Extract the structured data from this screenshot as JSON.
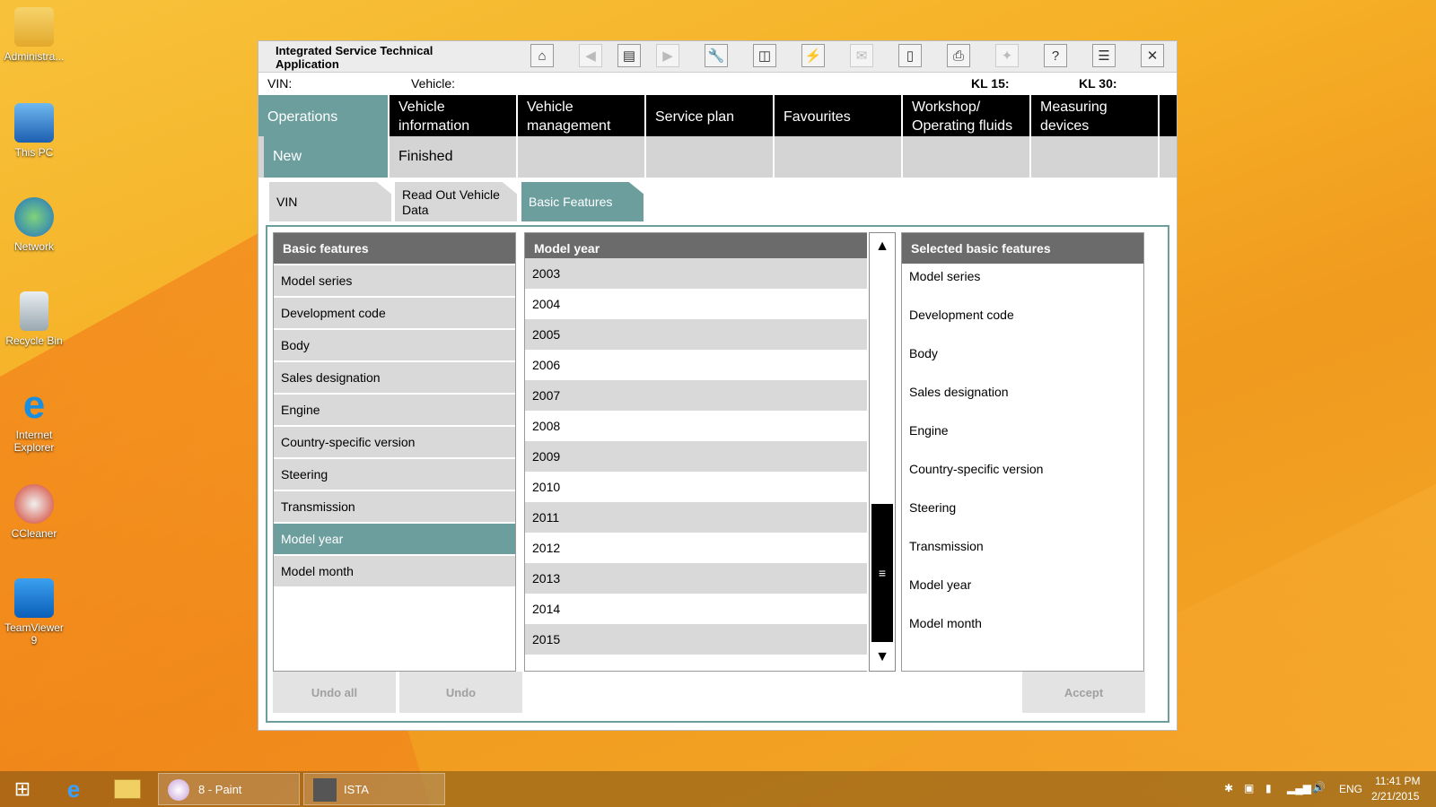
{
  "desktop": {
    "icons": [
      {
        "label": "Administra..."
      },
      {
        "label": "This PC"
      },
      {
        "label": "Network"
      },
      {
        "label": "Recycle Bin"
      },
      {
        "label": "Internet Explorer"
      },
      {
        "label": "CCleaner"
      },
      {
        "label": "TeamViewer 9"
      }
    ]
  },
  "window": {
    "title": "Integrated Service Technical Application",
    "status": {
      "vin": "VIN:",
      "vehicle": "Vehicle:",
      "kl15": "KL 15:",
      "kl30": "KL 30:"
    },
    "main_nav": [
      {
        "label": "Operations"
      },
      {
        "label": "Vehicle information"
      },
      {
        "label": "Vehicle management"
      },
      {
        "label": "Service plan"
      },
      {
        "label": "Favourites"
      },
      {
        "label": "Workshop/ Operating fluids"
      },
      {
        "label": "Measuring devices"
      }
    ],
    "sub_nav": [
      {
        "label": "New"
      },
      {
        "label": "Finished"
      }
    ],
    "tabs": [
      {
        "label": "VIN"
      },
      {
        "label": "Read Out Vehicle Data"
      },
      {
        "label": "Basic Features"
      }
    ],
    "basic_features": {
      "header": "Basic features",
      "items": [
        "Model series",
        "Development code",
        "Body",
        "Sales designation",
        "Engine",
        "Country-specific version",
        "Steering",
        "Transmission",
        "Model year",
        "Model month"
      ],
      "selected_index": 8
    },
    "model_year": {
      "header": "Model year",
      "items": [
        "2003",
        "2004",
        "2005",
        "2006",
        "2007",
        "2008",
        "2009",
        "2010",
        "2011",
        "2012",
        "2013",
        "2014",
        "2015"
      ]
    },
    "selected_features": {
      "header": "Selected basic features",
      "items": [
        "Model series",
        "Development code",
        "Body",
        "Sales designation",
        "Engine",
        "Country-specific version",
        "Steering",
        "Transmission",
        "Model year",
        "Model month"
      ]
    },
    "buttons": {
      "undo_all": "Undo all",
      "undo": "Undo",
      "accept": "Accept"
    }
  },
  "taskbar": {
    "paint_label": "8 - Paint",
    "ista_label": "ISTA",
    "lang": "ENG",
    "time": "11:41 PM",
    "date": "2/21/2015"
  }
}
